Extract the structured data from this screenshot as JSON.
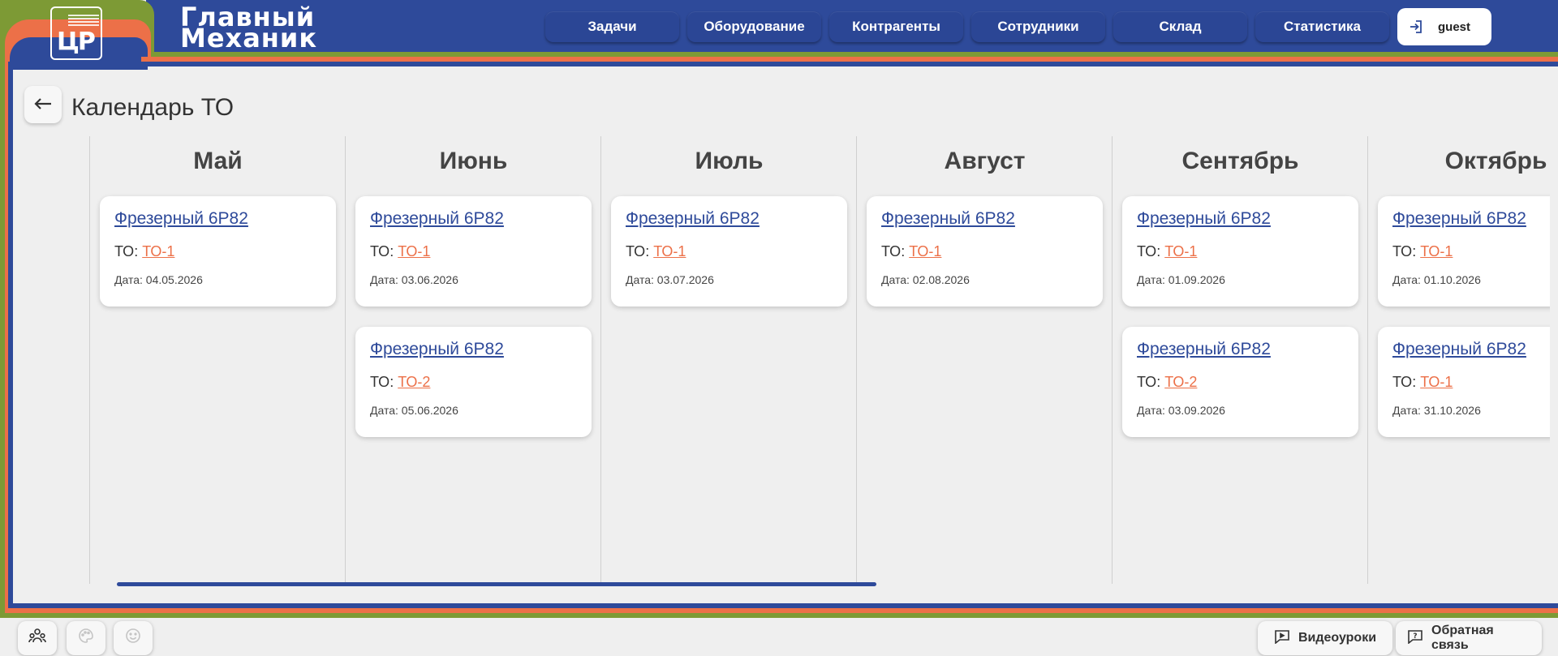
{
  "app": {
    "brand_line1": "Главный",
    "brand_line2": "Механик",
    "logo_mark": "ЦР"
  },
  "nav": {
    "items": [
      {
        "label": "Задачи"
      },
      {
        "label": "Оборудование"
      },
      {
        "label": "Контрагенты"
      },
      {
        "label": "Сотрудники"
      },
      {
        "label": "Склад"
      },
      {
        "label": "Статистика"
      }
    ],
    "user": {
      "label": "guest",
      "icon": "login-icon"
    }
  },
  "page": {
    "title": "Календарь ТО",
    "back_icon": "arrow-left-icon"
  },
  "labels": {
    "to_prefix": "ТО: ",
    "date_prefix": "Дата: "
  },
  "months": [
    {
      "name": "Май",
      "events": [
        {
          "equipment": "Фрезерный 6Р82",
          "to": "ТО-1",
          "date": "04.05.2026"
        }
      ]
    },
    {
      "name": "Июнь",
      "events": [
        {
          "equipment": "Фрезерный 6Р82",
          "to": "ТО-1",
          "date": "03.06.2026"
        },
        {
          "equipment": "Фрезерный 6Р82",
          "to": "ТО-2",
          "date": "05.06.2026"
        }
      ]
    },
    {
      "name": "Июль",
      "events": [
        {
          "equipment": "Фрезерный 6Р82",
          "to": "ТО-1",
          "date": "03.07.2026"
        }
      ]
    },
    {
      "name": "Август",
      "events": [
        {
          "equipment": "Фрезерный 6Р82",
          "to": "ТО-1",
          "date": "02.08.2026"
        }
      ]
    },
    {
      "name": "Сентябрь",
      "events": [
        {
          "equipment": "Фрезерный 6Р82",
          "to": "ТО-1",
          "date": "01.09.2026"
        },
        {
          "equipment": "Фрезерный 6Р82",
          "to": "ТО-2",
          "date": "03.09.2026"
        }
      ]
    },
    {
      "name": "Октябрь",
      "events": [
        {
          "equipment": "Фрезерный 6Р82",
          "to": "ТО-1",
          "date": "01.10.2026"
        },
        {
          "equipment": "Фрезерный 6Р82",
          "to": "ТО-1",
          "date": "31.10.2026"
        }
      ]
    }
  ],
  "footer": {
    "left_icons": [
      "team-icon",
      "palette-icon",
      "smiley-icon"
    ],
    "video_label": "Видеоуроки",
    "feedback_label": "Обратная связь"
  },
  "colors": {
    "brand_blue": "#2e4a9a",
    "accent_orange": "#ec7048",
    "accent_green": "#7d9a35"
  }
}
